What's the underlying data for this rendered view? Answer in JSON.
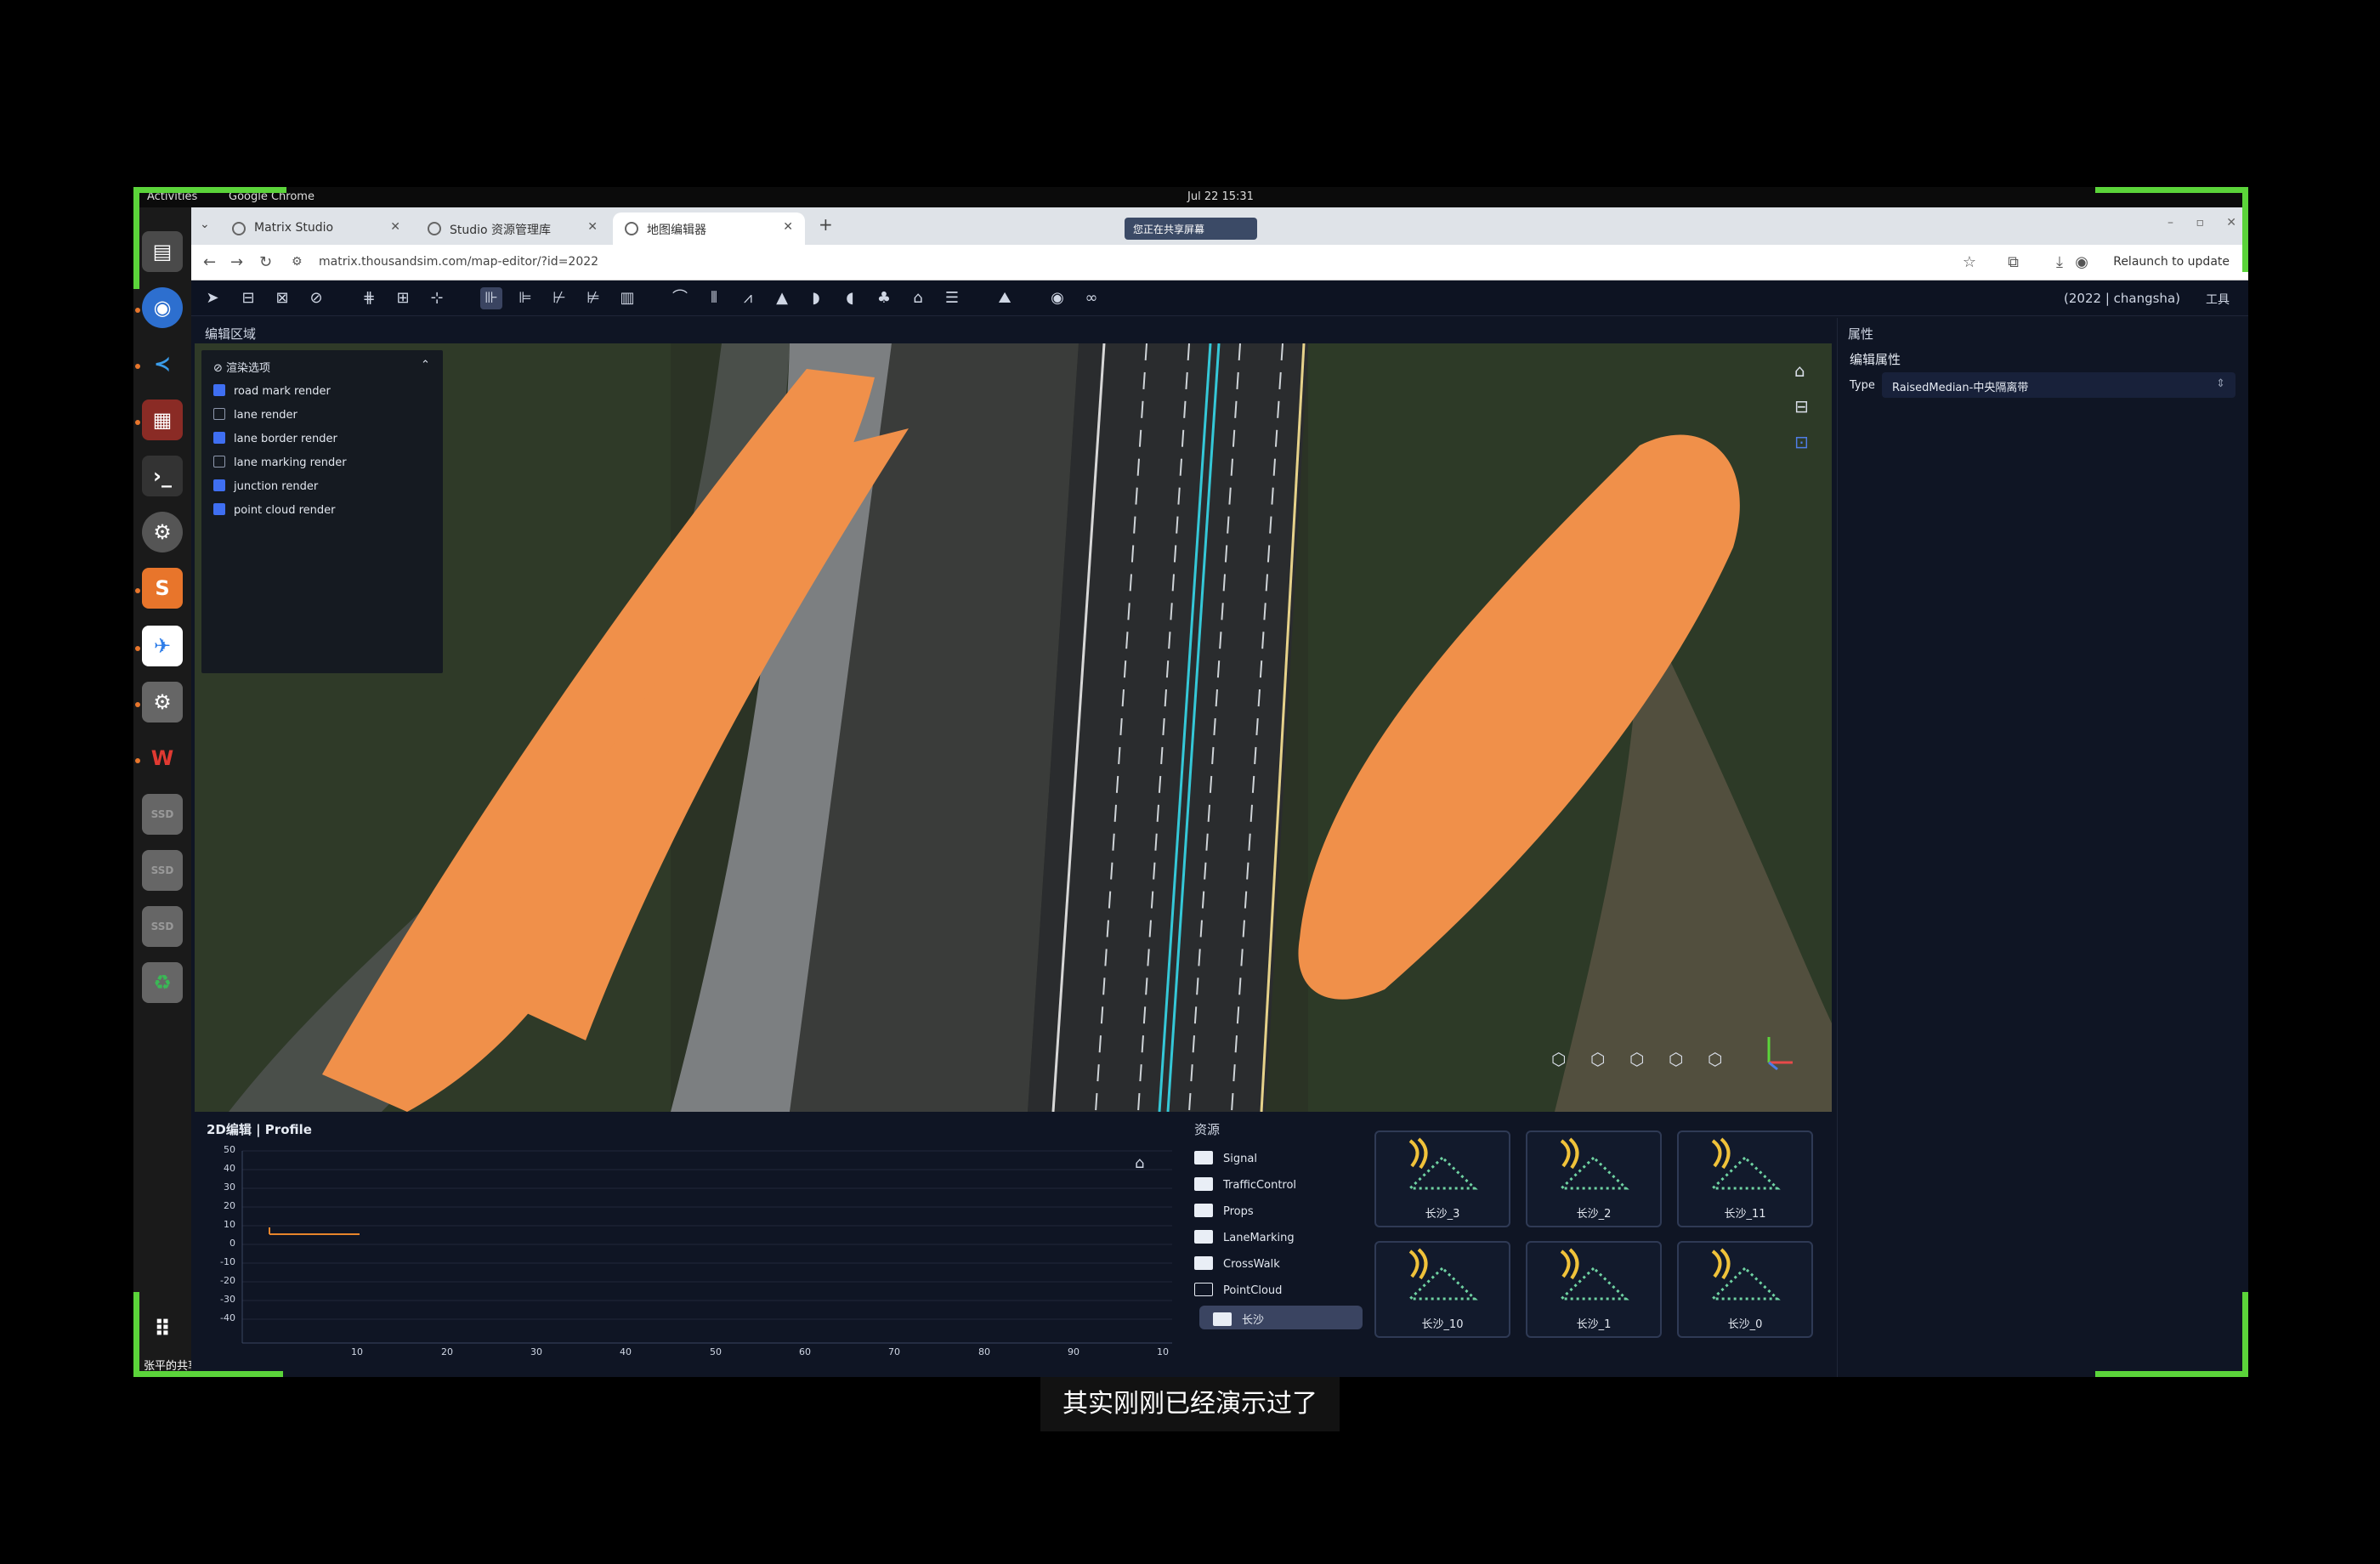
{
  "topbar": {
    "activities": "Activities",
    "app_name": "Google Chrome",
    "datetime": "Jul 22  15:31"
  },
  "browser": {
    "tabs": [
      {
        "label": "Matrix Studio"
      },
      {
        "label": "Studio 资源管理库"
      },
      {
        "label": "地图编辑器"
      }
    ],
    "new_tab": "+",
    "share_badge": "您正在共享屏幕",
    "url": "matrix.thousandsim.com/map-editor/?id=2022",
    "relaunch": "Relaunch to update"
  },
  "app": {
    "project": "(2022 | changsha)",
    "tools_label": "工具",
    "edit_area_title": "编辑区域",
    "render_panel": {
      "title": "渲染选项",
      "options": [
        {
          "label": "road mark render",
          "checked": true
        },
        {
          "label": "lane render",
          "checked": false
        },
        {
          "label": "lane border render",
          "checked": true
        },
        {
          "label": "lane marking render",
          "checked": false
        },
        {
          "label": "junction render",
          "checked": true
        },
        {
          "label": "point cloud render",
          "checked": true
        }
      ]
    },
    "profile": {
      "title": "2D编辑 | Profile",
      "y_ticks": [
        "50",
        "40",
        "30",
        "20",
        "10",
        "0",
        "-10",
        "-20",
        "-30",
        "-40"
      ],
      "x_ticks": [
        "10",
        "20",
        "30",
        "40",
        "50",
        "60",
        "70",
        "80",
        "90",
        "10"
      ]
    },
    "resources": {
      "title": "资源",
      "folders": [
        "Signal",
        "TrafficControl",
        "Props",
        "LaneMarking",
        "CrossWalk",
        "PointCloud",
        "长沙"
      ],
      "cards": [
        "长沙_3",
        "长沙_2",
        "长沙_11",
        "长沙_10",
        "长沙_1",
        "长沙_0"
      ]
    },
    "properties": {
      "title": "属性",
      "subtitle": "编辑属性",
      "type_label": "Type",
      "type_value": "RaisedMedian-中央隔离带"
    }
  },
  "dock_footer": "张平的共享屏幕",
  "subtitle": "其实刚刚已经演示过了"
}
